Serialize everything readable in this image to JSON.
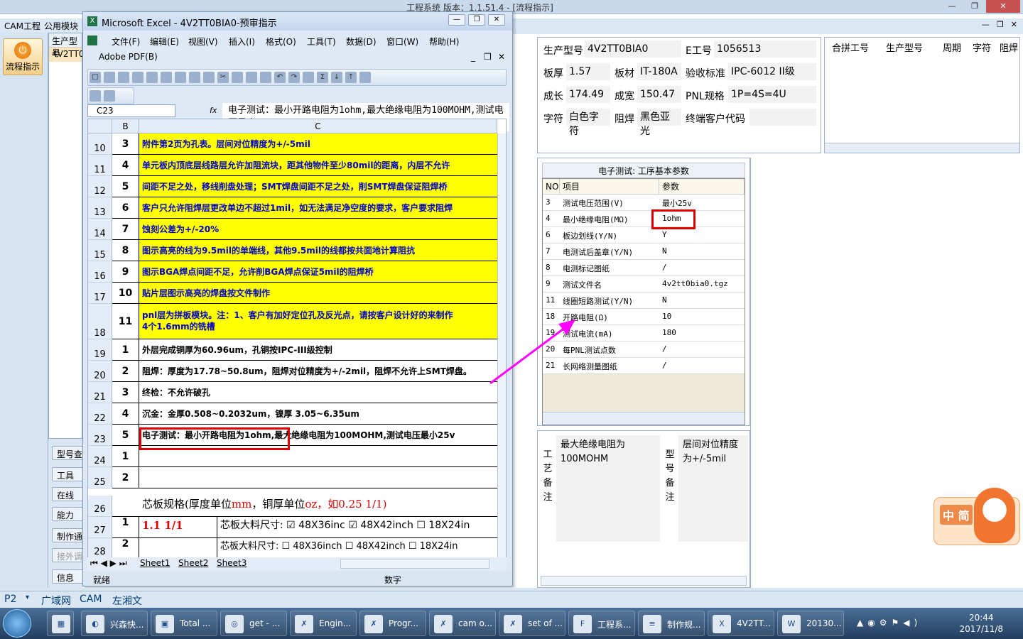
{
  "app_title": "工程系统    版本：1.1.51.4 - [流程指示]",
  "app_menu": [
    "CAM工程",
    "公用模块"
  ],
  "left_button": "流程指示",
  "mid_grid": {
    "header": "生产型号",
    "row": "4V2TT0"
  },
  "side_buttons": [
    "型号查",
    "工具",
    "在线",
    "能力",
    "制作通",
    "接外调",
    "信息"
  ],
  "excel": {
    "title": "Microsoft Excel - 4V2TT0BIA0-预审指示",
    "menu": [
      "文件(F)",
      "编辑(E)",
      "视图(V)",
      "插入(I)",
      "格式(O)",
      "工具(T)",
      "数据(D)",
      "窗口(W)",
      "帮助(H)"
    ],
    "menu2": "Adobe PDF(B)",
    "name_box": "C23",
    "fx": "fx",
    "formula": "电子测试：最小开路电阻为1ohm,最大绝缘电阻为100MOHM,测试电压最小25v",
    "col_b": "B",
    "col_c": "C",
    "rows": [
      {
        "r": "10",
        "b": "3",
        "c": "附件第2页为孔表。层间对位精度为+/-5mil",
        "yellow": true
      },
      {
        "r": "11",
        "b": "4",
        "c": "单元板内顶底层线路层允许加阻流块，距其他物件至少80mil的距离，内层不允许",
        "yellow": true
      },
      {
        "r": "12",
        "b": "5",
        "c": "间距不足之处，移线削盘处理；SMT焊盘间距不足之处，削SMT焊盘保证阻焊桥",
        "yellow": true
      },
      {
        "r": "13",
        "b": "6",
        "c": "客户只允许阻焊层更改单边不超过1mil，如无法满足净空度的要求，客户要求阻焊",
        "yellow": true
      },
      {
        "r": "14",
        "b": "7",
        "c": "蚀刻公差为+/-20%",
        "yellow": true
      },
      {
        "r": "15",
        "b": "8",
        "c": "图示高亮的线为9.5mil的单端线，其他9.5mil的线都按共面地计算阻抗",
        "yellow": true
      },
      {
        "r": "16",
        "b": "9",
        "c": "图示BGA焊点间距不足，允许削BGA焊点保证5mil的阻焊桥",
        "yellow": true
      },
      {
        "r": "17",
        "b": "10",
        "c": "贴片层图示高亮的焊盘按文件制作",
        "yellow": true
      },
      {
        "r": "18",
        "b": "11",
        "c": "pnl层为拼板模块。注：1、客户有加好定位孔及反光点，请按客户设计好的来制作",
        "c2": "4个1.6mm的铣槽",
        "yellow": true
      },
      {
        "r": "19",
        "b": "1",
        "c": "外层完成铜厚为60.96um，孔铜按IPC-III级控制",
        "yellow": false
      },
      {
        "r": "20",
        "b": "2",
        "c": "阻焊：厚度为17.78~50.8um，阻焊对位精度为+/-2mil，阻焊不允许上SMT焊盘。",
        "yellow": false
      },
      {
        "r": "21",
        "b": "3",
        "c": "终检：不允许破孔",
        "yellow": false
      },
      {
        "r": "22",
        "b": "4",
        "c": "沉金：金厚0.508~0.2032um，镍厚 3.05~6.35um",
        "yellow": false
      },
      {
        "r": "23",
        "b": "5",
        "c": "电子测试：最小开路电阻为1ohm,最大绝缘电阻为100MOHM,测试电压最小25v",
        "yellow": false
      },
      {
        "r": "24",
        "b": "1",
        "c": "",
        "yellow": false
      },
      {
        "r": "25",
        "b": "2",
        "c": "",
        "yellow": false
      }
    ],
    "row26": {
      "r": "26",
      "label": "芯板规格(厚度单位",
      "mm": "mm",
      "mid": "，铜厚单位",
      "oz": "oz",
      "end": "，如0.25 1/1)"
    },
    "row27": {
      "r": "27",
      "b": "1",
      "spec": "1.1 1/1",
      "label": "芯板大料尺寸:",
      "o1": "☑ 48X36inc",
      "o2": "☑ 48X42inch",
      "o3": "☐ 18X24in"
    },
    "row28": {
      "r": "28",
      "b": "2",
      "label": "芯板大料尺寸:",
      "o1": "☐ 48X36inch",
      "o2": "☐ 48X42inch",
      "o3": "☐ 18X24in"
    },
    "sheets": [
      "Sheet1",
      "Sheet2",
      "Sheet3"
    ],
    "status_ready": "就绪",
    "status_num": "数字"
  },
  "form": {
    "model_label": "生产型号",
    "model_value": "4V2TT0BIA0",
    "eno_label": "E工号",
    "eno_value": "1056513",
    "thick_label": "板厚",
    "thick_value": "1.57",
    "mat_label": "板材",
    "mat_value": "IT-180A",
    "std_label": "验收标准",
    "std_value": "IPC-6012 II级",
    "len_label": "成长",
    "len_value": "174.49",
    "wid_label": "成宽",
    "wid_value": "150.47",
    "pnl_label": "PNL规格",
    "pnl_value": "1P=4S=4U",
    "char_label": "字符",
    "char_value": "白色字符",
    "mask_label": "阻焊",
    "mask_value": "黑色亚光",
    "cust_label": "终端客户代码",
    "cust_value": ""
  },
  "merge_grid": {
    "headers": [
      "合拼工号",
      "生产型号",
      "周期",
      "字符",
      "阻焊"
    ]
  },
  "params": {
    "title": "电子测试: 工序基本参数",
    "headers": [
      "NO",
      "项目",
      "参数"
    ],
    "rows": [
      {
        "no": "3",
        "item": "测试电压范围(V)",
        "val": "最小25v"
      },
      {
        "no": "4",
        "item": "最小绝缘电阻(MΩ)",
        "val": "1ohm"
      },
      {
        "no": "6",
        "item": "板边划线(Y/N)",
        "val": "Y"
      },
      {
        "no": "7",
        "item": "电测试后盖章(Y/N)",
        "val": "N"
      },
      {
        "no": "8",
        "item": "电测标记图纸",
        "val": "/"
      },
      {
        "no": "9",
        "item": "测试文件名",
        "val": "4v2tt0bia0.tgz"
      },
      {
        "no": "11",
        "item": "线圈短路测试(Y/N)",
        "val": "N"
      },
      {
        "no": "18",
        "item": "开路电阻(Ω)",
        "val": "10"
      },
      {
        "no": "19",
        "item": "测试电流(mA)",
        "val": "180"
      },
      {
        "no": "20",
        "item": "每PNL测试点数",
        "val": "/"
      },
      {
        "no": "21",
        "item": "长网络测量图纸",
        "val": "/"
      }
    ]
  },
  "notes": {
    "craft_label": "工艺备注",
    "craft_text": "最大绝缘电阻为100MOHM",
    "model_label": "型号备注",
    "model_text": "层间对位精度为+/-5mil"
  },
  "nav": [
    "P2",
    "广域网",
    "CAM",
    "左湘文"
  ],
  "ime": "中 简",
  "taskbar": [
    {
      "icon": "app",
      "label": "兴森快..."
    },
    {
      "icon": "disk",
      "label": "Total ..."
    },
    {
      "icon": "fish",
      "label": "get - ..."
    },
    {
      "icon": "x",
      "label": "Engin..."
    },
    {
      "icon": "x",
      "label": "Progr..."
    },
    {
      "icon": "x",
      "label": "cam o..."
    },
    {
      "icon": "x",
      "label": "set of ..."
    },
    {
      "icon": "f",
      "label": "工程系..."
    },
    {
      "icon": "doc",
      "label": "制作规..."
    },
    {
      "icon": "xl",
      "label": "4V2TT..."
    },
    {
      "icon": "w",
      "label": "20130..."
    }
  ],
  "clock": {
    "time": "20:44",
    "date": "2017/11/8"
  },
  "colors": {
    "yellow": "#ffff00",
    "blue_text": "#0000c8",
    "highlight": "#e00000",
    "arrow": "#ff00ff"
  }
}
